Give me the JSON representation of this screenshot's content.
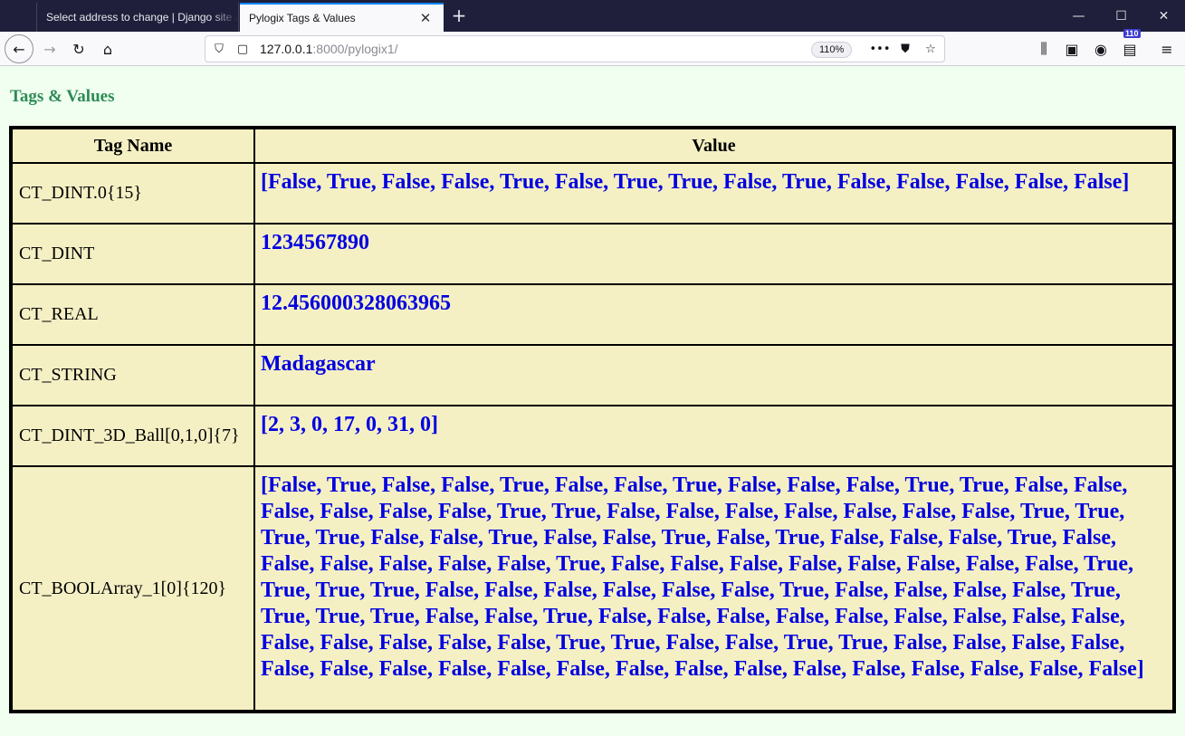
{
  "browser": {
    "tabs": [
      {
        "title": "Select address to change | Django site admin",
        "active": false
      },
      {
        "title": "Pylogix Tags & Values",
        "active": true
      }
    ],
    "url_host": "127.0.0.1",
    "url_rest": ":8000/pylogix1/",
    "zoom": "110%",
    "pocket_badge": "110"
  },
  "page": {
    "heading": "Tags & Values",
    "columns": [
      "Tag Name",
      "Value"
    ],
    "rows": [
      {
        "name": "CT_DINT.0{15}",
        "value": "[False, True, False, False, True, False, True, True, False, True, False, False, False, False, False]"
      },
      {
        "name": "CT_DINT",
        "value": "1234567890"
      },
      {
        "name": "CT_REAL",
        "value": "12.456000328063965"
      },
      {
        "name": "CT_STRING",
        "value": "Madagascar"
      },
      {
        "name": "CT_DINT_3D_Ball[0,1,0]{7}",
        "value": "[2, 3, 0, 17, 0, 31, 0]"
      },
      {
        "name": "CT_BOOLArray_1[0]{120}",
        "value": "[False, True, False, False, True, False, False, True, False, False, False, True, True, False, False, False, False, False, False, True, True, False, False, False, False, False, False, False, True, True, True, True, False, False, True, False, False, True, False, True, False, False, False, True, False, False, False, False, False, False, True, False, False, False, False, False, False, False, False, True, True, True, True, False, False, False, False, False, False, True, False, False, False, False, True, True, True, True, False, False, True, False, False, False, False, False, False, False, False, False, False, False, False, False, False, True, True, False, False, True, True, False, False, False, False, False, False, False, False, False, False, False, False, False, False, False, False, False, False, False]"
      }
    ]
  }
}
